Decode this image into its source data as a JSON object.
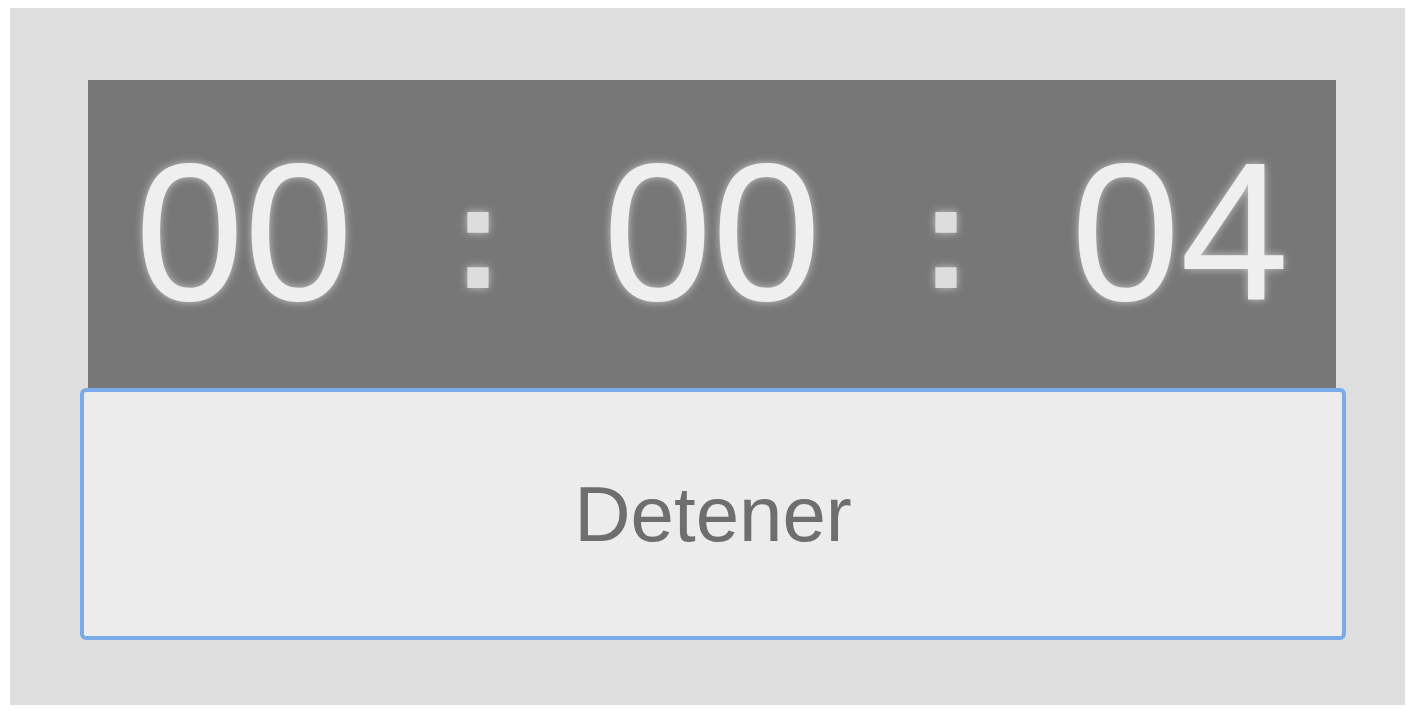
{
  "timer": {
    "parts": [
      {
        "text": "00",
        "kind": "digits"
      },
      {
        "text": ":",
        "kind": "separator"
      },
      {
        "text": "00",
        "kind": "digits"
      },
      {
        "text": ":",
        "kind": "separator"
      },
      {
        "text": "04",
        "kind": "digits"
      }
    ]
  },
  "button": {
    "label": "Detener",
    "focused": true
  }
}
